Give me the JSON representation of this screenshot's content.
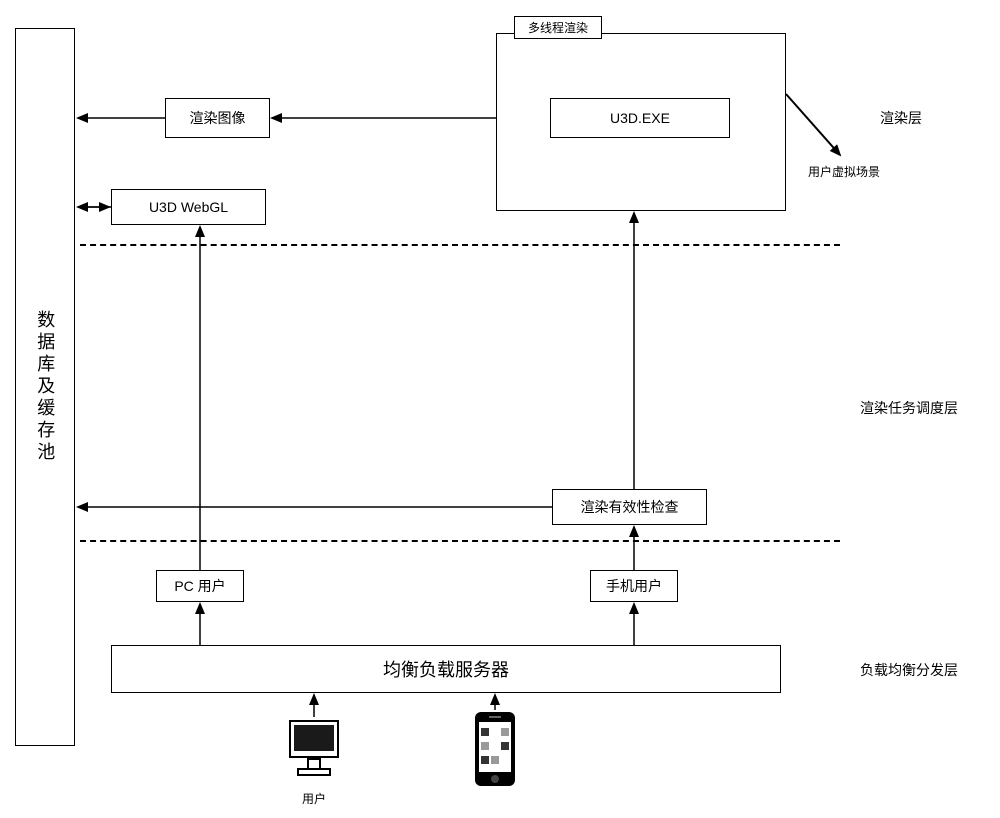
{
  "left_column": {
    "label": "数据库及缓存池"
  },
  "render_layer": {
    "label": "渲染层",
    "multi_thread_tab": "多线程渲染",
    "u3d_exe": "U3D.EXE",
    "render_image": "渲染图像",
    "u3d_webgl": "U3D  WebGL",
    "user_virtual_scene": "用户虚拟场景"
  },
  "task_layer": {
    "label": "渲染任务调度层",
    "validity_check": "渲染有效性检查"
  },
  "dist_layer": {
    "label": "负载均衡分发层",
    "pc_user": "PC 用户",
    "mobile_user": "手机用户",
    "lb_server": "均衡负载服务器",
    "user_label": "用户"
  }
}
